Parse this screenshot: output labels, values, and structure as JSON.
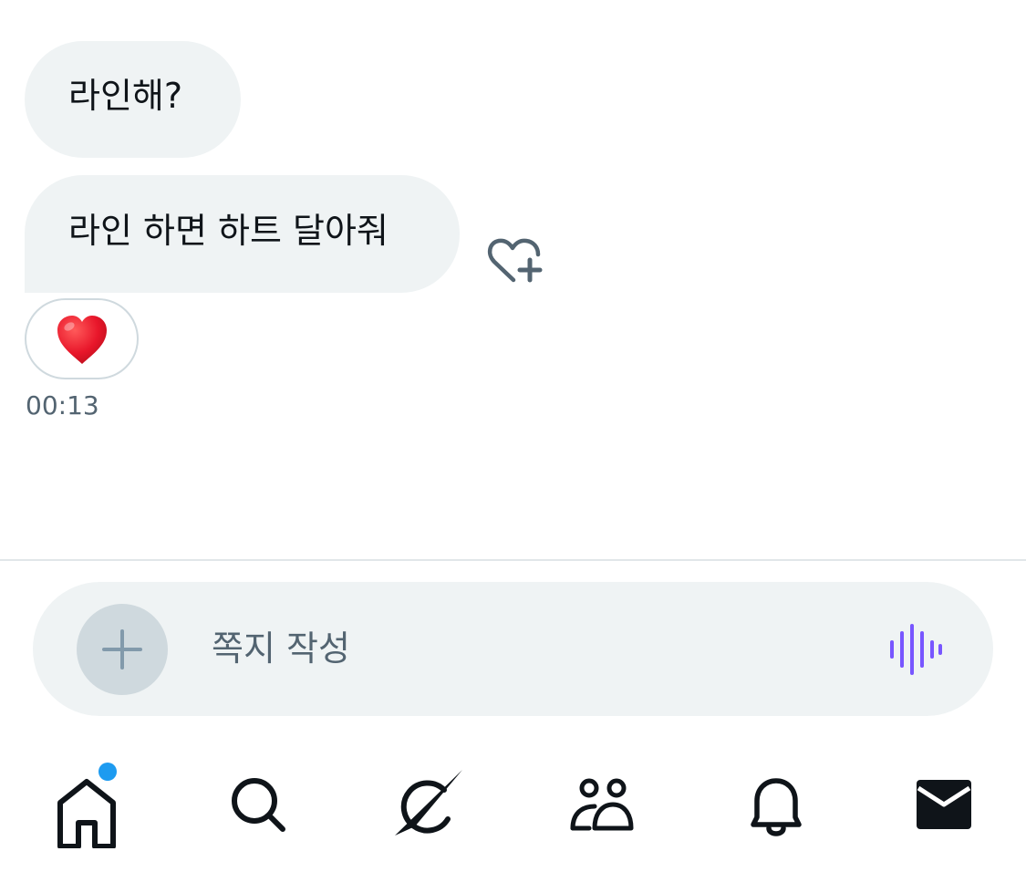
{
  "messages": [
    {
      "text": "라인해?"
    },
    {
      "text": "라인 하면 하트 달아줘"
    }
  ],
  "reaction": {
    "emoji_icon": "red-heart-icon",
    "add_reaction_icon": "heart-plus-icon"
  },
  "timestamp": "00:13",
  "composer": {
    "placeholder": "쪽지 작성",
    "add_icon": "plus-icon",
    "voice_icon": "voice-waveform-icon",
    "voice_color": "#7856ff"
  },
  "tabbar": {
    "items": [
      "home-icon",
      "search-icon",
      "grok-icon",
      "communities-icon",
      "notifications-icon",
      "messages-icon"
    ],
    "notification_dot_color": "#1d9bf0"
  }
}
